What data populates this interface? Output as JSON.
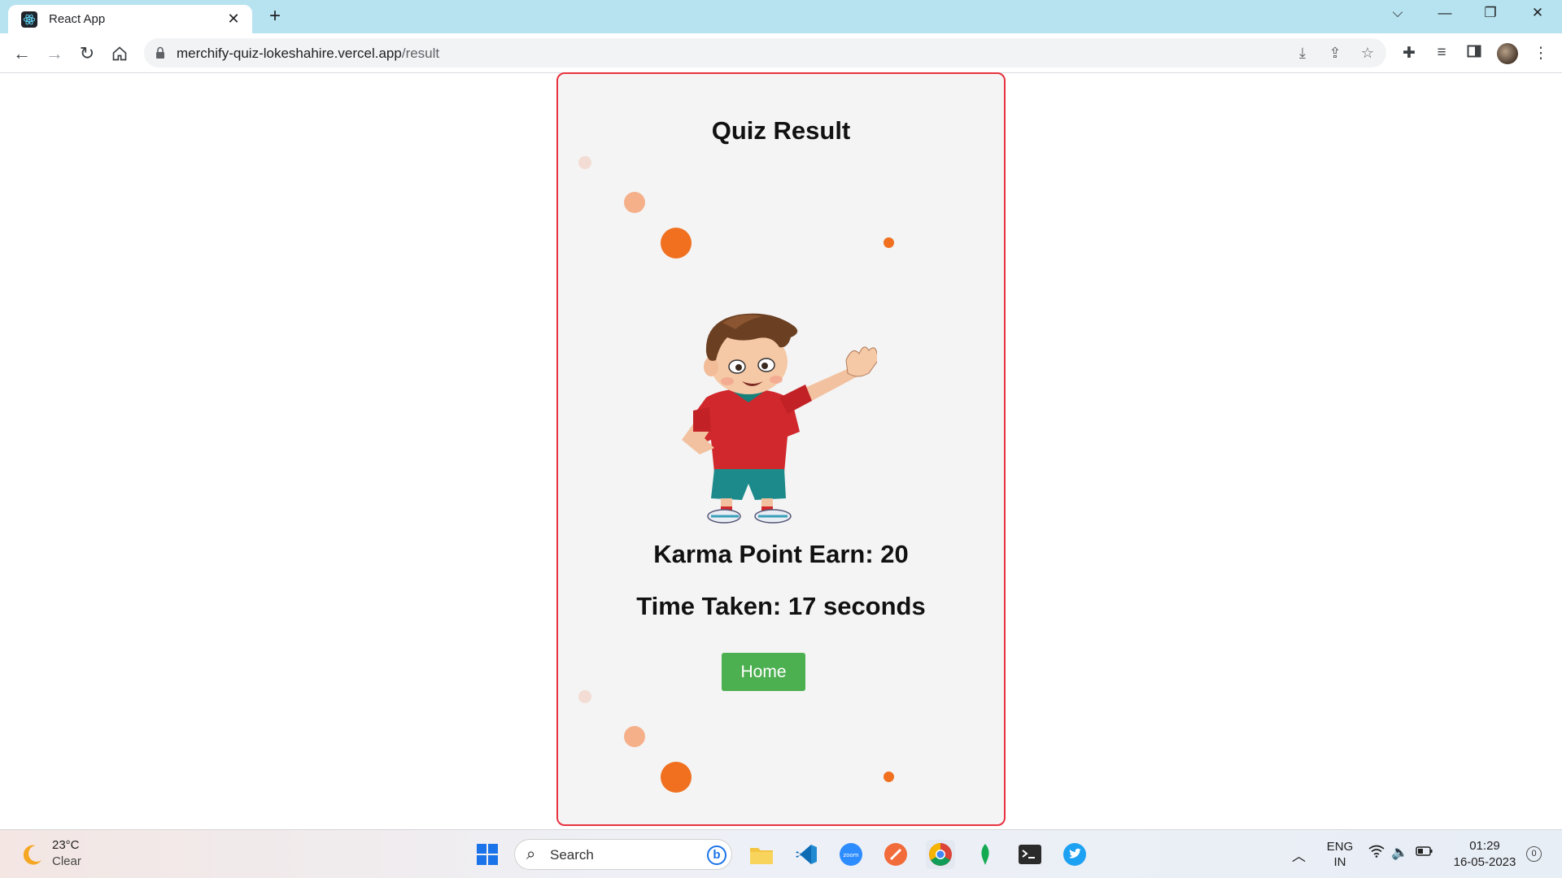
{
  "browser": {
    "tab_title": "React App",
    "url_host": "merchify-quiz-lokeshahire.vercel.app",
    "url_path": "/result"
  },
  "page": {
    "title": "Quiz Result",
    "karma_text": "Karma Point Earn: 20",
    "time_text": "Time Taken: 17 seconds",
    "home_button": "Home",
    "colors": {
      "card_bg": "#f4f4f4",
      "card_border": "#e8323f",
      "button_bg": "#4caf50",
      "dot_dark": "#f07020",
      "dot_light": "#f5b08a",
      "dot_faint": "#f3dcd4"
    }
  },
  "taskbar": {
    "weather_temp": "23°C",
    "weather_cond": "Clear",
    "search_placeholder": "Search",
    "lang_top": "ENG",
    "lang_bottom": "IN",
    "time": "01:29",
    "date": "16-05-2023",
    "notifications": "0",
    "apps": [
      "start-icon",
      "search-icon",
      "bing-icon",
      "file-explorer-icon",
      "vscode-icon",
      "zoom-icon",
      "compass-app-icon",
      "chrome-icon",
      "mongodb-icon",
      "terminal-icon",
      "twitter-icon"
    ]
  }
}
